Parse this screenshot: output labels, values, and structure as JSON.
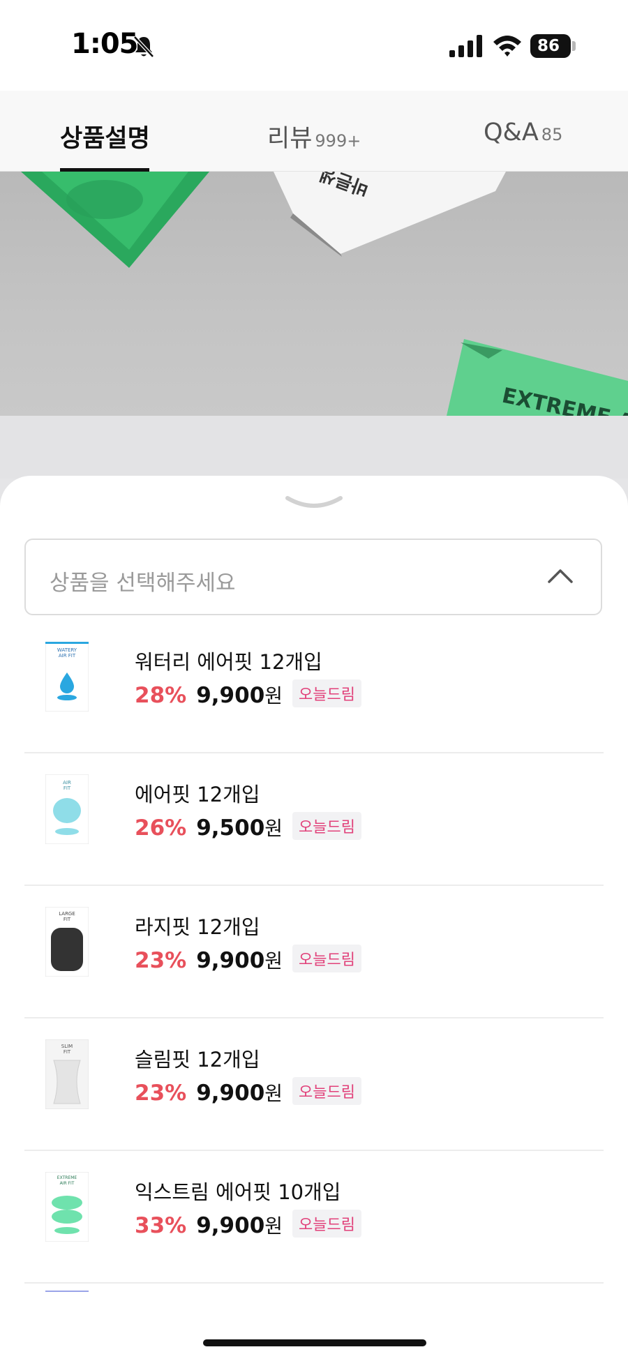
{
  "status_bar": {
    "time": "1:05",
    "battery": "86",
    "icons": [
      "bell-slash-icon",
      "signal-icon",
      "wifi-icon",
      "battery-icon"
    ]
  },
  "tabs": [
    {
      "label": "상품설명",
      "count": "",
      "active": true
    },
    {
      "label": "리뷰",
      "count": "999+",
      "active": false
    },
    {
      "label": "Q&A",
      "count": "85",
      "active": false
    }
  ],
  "hero": {
    "caption": "EXTREME A",
    "packet_text": "바른생"
  },
  "sheet": {
    "select_placeholder": "상품을 선택해주세요",
    "products": [
      {
        "name": "워터리 에어핏 12개입",
        "discount": "28%",
        "price": "9,900",
        "unit": "원",
        "badge": "오늘드림",
        "thumb_label": "WATERY AIR FIT",
        "thumb_color": "#2aa7e0"
      },
      {
        "name": "에어핏 12개입",
        "discount": "26%",
        "price": "9,500",
        "unit": "원",
        "badge": "오늘드림",
        "thumb_label": "AIR FIT",
        "thumb_color": "#8fdde8"
      },
      {
        "name": "라지핏 12개입",
        "discount": "23%",
        "price": "9,900",
        "unit": "원",
        "badge": "오늘드림",
        "thumb_label": "LARGE FIT",
        "thumb_color": "#333333"
      },
      {
        "name": "슬림핏 12개입",
        "discount": "23%",
        "price": "9,900",
        "unit": "원",
        "badge": "오늘드림",
        "thumb_label": "SLIM FIT",
        "thumb_color": "#e4e4e4"
      },
      {
        "name": "익스트림 에어핏 10개입",
        "discount": "33%",
        "price": "9,900",
        "unit": "원",
        "badge": "오늘드림",
        "thumb_label": "EXTREME AIR FIT",
        "thumb_color": "#6fe2ad"
      }
    ]
  },
  "colors": {
    "discount": "#e8505b",
    "badge_text": "#e1417a",
    "accent_green": "#3fc47a"
  }
}
